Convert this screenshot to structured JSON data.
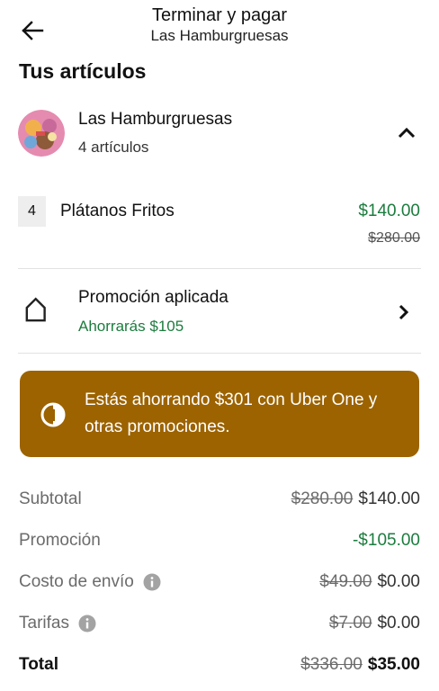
{
  "header": {
    "title": "Terminar y pagar",
    "subtitle": "Las Hamburgruesas"
  },
  "section_title": "Tus artículos",
  "store": {
    "name": "Las Hamburgruesas",
    "count": "4 artículos"
  },
  "item": {
    "qty": "4",
    "name": "Plátanos Fritos",
    "price": "$140.00",
    "old_price": "$280.00"
  },
  "promo": {
    "title": "Promoción aplicada",
    "subtitle": "Ahorrarás $105"
  },
  "banner": {
    "text": "Estás ahorrando $301 con Uber One y otras promociones.",
    "color": "#9c6300"
  },
  "summary": {
    "subtotal": {
      "label": "Subtotal",
      "old": "$280.00",
      "value": "$140.00"
    },
    "promotion": {
      "label": "Promoción",
      "value": "-$105.00"
    },
    "delivery": {
      "label": "Costo de envío",
      "old": "$49.00",
      "value": "$0.00"
    },
    "fees": {
      "label": "Tarifas",
      "old": "$7.00",
      "value": "$0.00"
    },
    "total": {
      "label": "Total",
      "old": "$336.00",
      "value": "$35.00"
    }
  },
  "colors": {
    "green": "#1c7c3e",
    "gray_text": "#6b6b6b"
  },
  "icons": {
    "back": "arrow-left-icon",
    "collapse": "chevron-up-icon",
    "promo": "tag-icon",
    "promo_open": "chevron-right-icon",
    "uber_one": "uber-one-icon",
    "info": "info-icon"
  }
}
